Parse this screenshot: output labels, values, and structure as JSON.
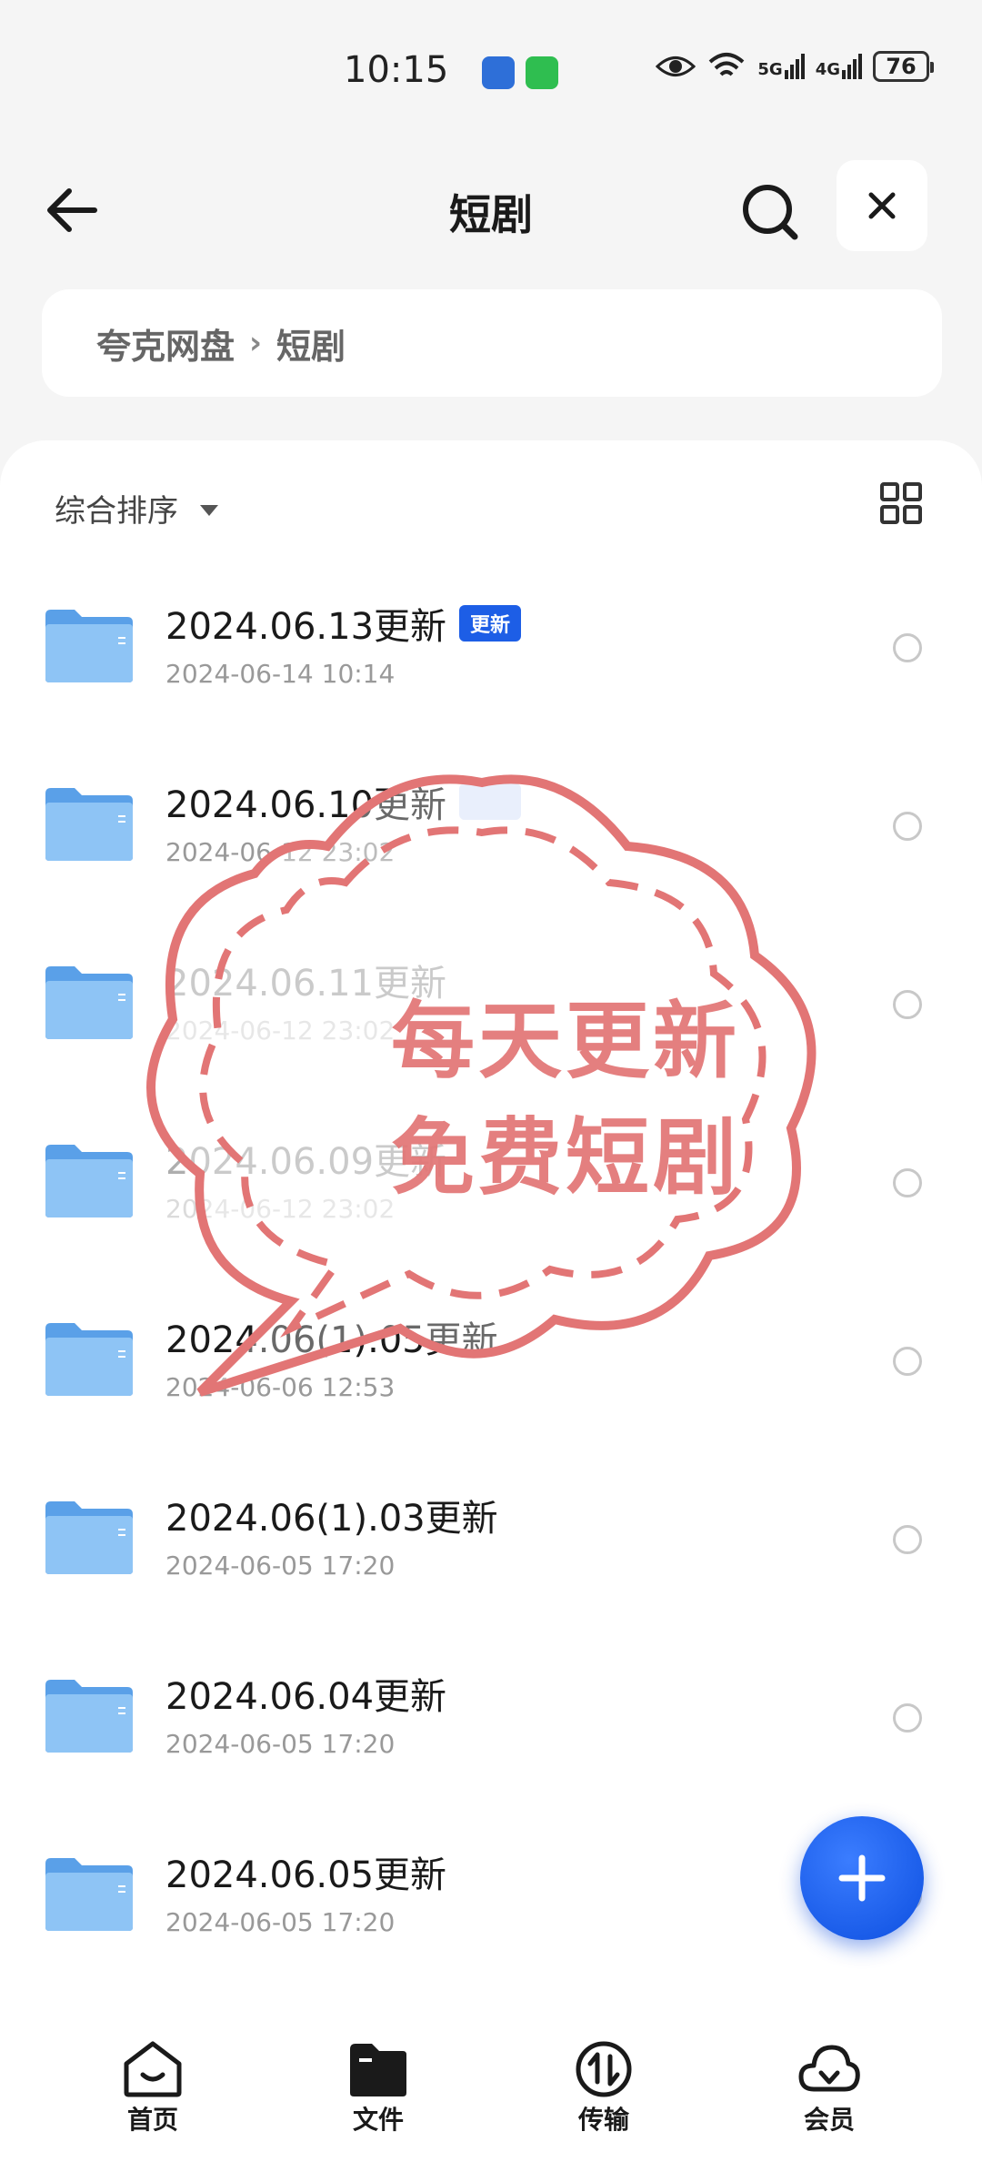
{
  "status_bar": {
    "time": "10:15",
    "battery": "76",
    "network_5g": "5G",
    "network_4g": "4G",
    "icons": [
      "eye-icon",
      "wifi-icon",
      "signal-5g-icon",
      "signal-4g-icon",
      "battery-icon"
    ]
  },
  "header": {
    "title": "短剧"
  },
  "breadcrumb": {
    "items": [
      "夸克网盘",
      "短剧"
    ],
    "separator": "›"
  },
  "toolbar": {
    "sort_label": "综合排序"
  },
  "files": [
    {
      "name": "2024.06.13更新",
      "time": "2024-06-14 10:14",
      "badge": "更新"
    },
    {
      "name": "2024.06.10更新",
      "time": "2024-06-12 23:02",
      "badge": "更新"
    },
    {
      "name": "2024.06.11更新",
      "time": "2024-06-12 23:02",
      "badge": ""
    },
    {
      "name": "2024.06.09更新",
      "time": "2024-06-12 23:02",
      "badge": ""
    },
    {
      "name": "2024.06(1).05更新",
      "time": "2024-06-06 12:53",
      "badge": ""
    },
    {
      "name": "2024.06(1).03更新",
      "time": "2024-06-05 17:20",
      "badge": ""
    },
    {
      "name": "2024.06.04更新",
      "time": "2024-06-05 17:20",
      "badge": ""
    },
    {
      "name": "2024.06.05更新",
      "time": "2024-06-05 17:20",
      "badge": ""
    }
  ],
  "stamp": {
    "line1": "每天更新",
    "line2": "免费短剧",
    "color": "#e27575"
  },
  "bottom_nav": [
    {
      "label": "首页",
      "icon": "home-icon"
    },
    {
      "label": "文件",
      "icon": "folder-icon"
    },
    {
      "label": "传输",
      "icon": "transfer-icon"
    },
    {
      "label": "会员",
      "icon": "cloud-icon"
    }
  ],
  "colors": {
    "accent": "#1d5ee6",
    "folder": "#7fb8f2",
    "background": "#f5f5f5"
  }
}
